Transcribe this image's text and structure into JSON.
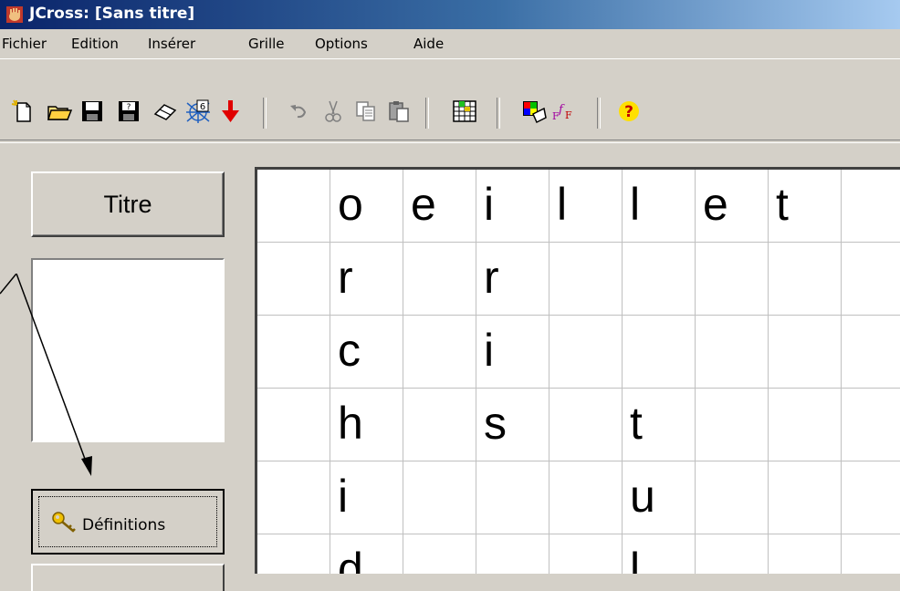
{
  "window": {
    "title": "JCross: [Sans titre]",
    "app_icon": "jcross-hand-icon"
  },
  "menu": [
    "Fichier",
    "Edition",
    "Insérer",
    "Grille",
    "Options",
    "Aide"
  ],
  "toolbar": {
    "icons": [
      "new-file-icon",
      "open-folder-icon",
      "save-icon",
      "save-as-icon",
      "eraser-icon",
      "web-export-icon",
      "red-arrow-down-icon",
      "undo-icon",
      "cut-icon",
      "copy-icon",
      "paste-icon",
      "grid-icon",
      "colors-icon",
      "font-icon",
      "help-icon"
    ]
  },
  "left_panel": {
    "titre_label": "Titre",
    "definitions_label": "Définitions"
  },
  "grid": {
    "rows": [
      [
        "",
        "o",
        "e",
        "i",
        "l",
        "l",
        "e",
        "t",
        ""
      ],
      [
        "",
        "r",
        "",
        "r",
        "",
        "",
        "",
        "",
        ""
      ],
      [
        "",
        "c",
        "",
        "i",
        "",
        "",
        "",
        "",
        ""
      ],
      [
        "",
        "h",
        "",
        "s",
        "",
        "t",
        "",
        "",
        ""
      ],
      [
        "",
        "i",
        "",
        "",
        "",
        "u",
        "",
        "",
        ""
      ],
      [
        "",
        "d",
        "",
        "",
        "",
        "l",
        "",
        "",
        ""
      ]
    ]
  }
}
